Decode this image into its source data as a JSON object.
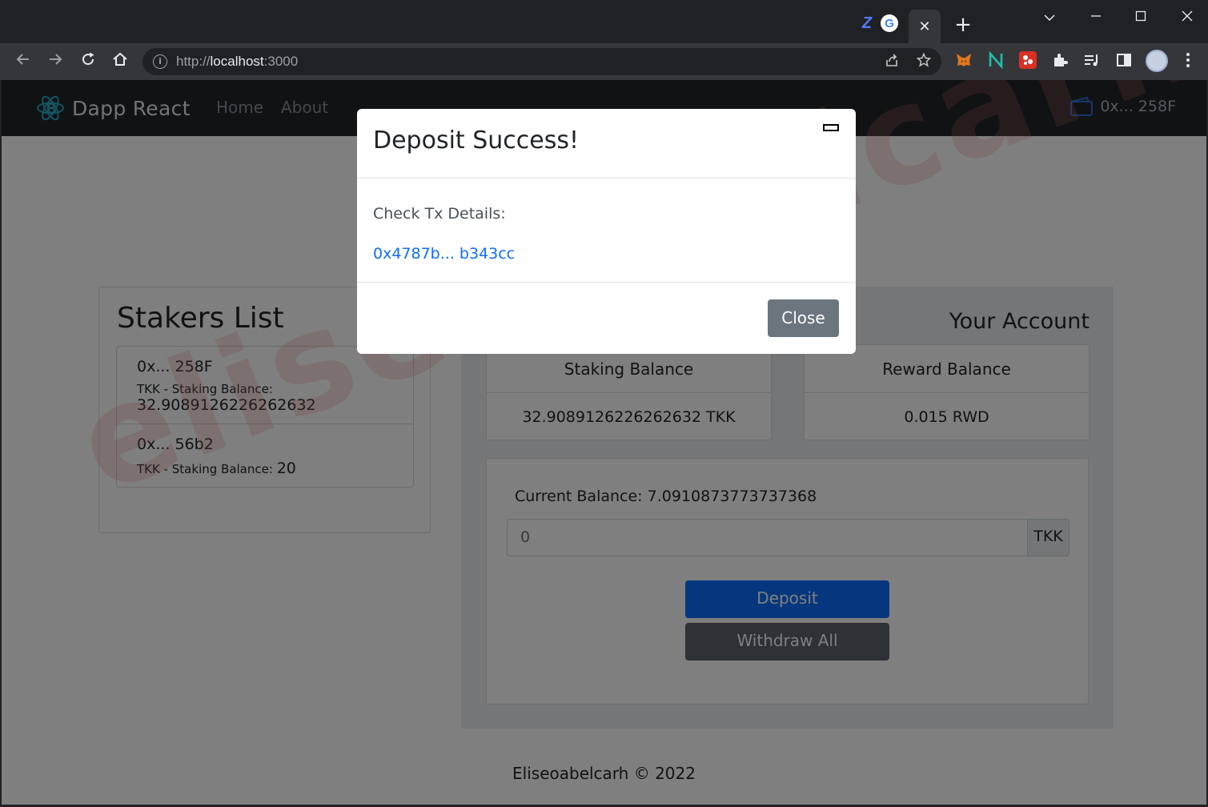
{
  "browser": {
    "url_scheme": "http://",
    "url_host": "localhost",
    "url_port": ":3000",
    "tab_close_glyph": "✕",
    "new_tab_glyph": "+"
  },
  "navbar": {
    "brand": "Dapp React",
    "links": [
      "Home",
      "About"
    ],
    "wallet_address": "0x... 258F"
  },
  "stakers": {
    "title": "Stakers List",
    "items": [
      {
        "address": "0x... 258F",
        "label": "TKK - Staking Balance:",
        "balance": "32.9089126226262632"
      },
      {
        "address": "0x... 56b2",
        "label": "TKK - Staking Balance:",
        "balance": "20"
      }
    ]
  },
  "account": {
    "title": "Your Account",
    "staking_balance_label": "Staking Balance",
    "staking_balance_value": "32.9089126226262632 TKK",
    "reward_balance_label": "Reward Balance",
    "reward_balance_value": "0.015 RWD",
    "current_balance": "Current Balance: 7.0910873773737368",
    "amount_value": "0",
    "amount_unit": "TKK",
    "deposit_label": "Deposit",
    "withdraw_label": "Withdraw All"
  },
  "footer": {
    "text": "Eliseoabelcarh © 2022"
  },
  "watermark": "eliseoabelcarh",
  "modal": {
    "title": "Deposit Success!",
    "body_label": "Check Tx Details:",
    "tx_link": "0x4787b... b343cc",
    "close_label": "Close"
  },
  "colors": {
    "navbar": "#212529",
    "primary": "#0d6efd",
    "secondary": "#6c757d",
    "brand_logo": "#61dafb"
  },
  "icons": [
    "info-icon",
    "share-icon",
    "star-icon",
    "metamask-icon",
    "extension-n-icon",
    "extension-red-icon",
    "puzzle-icon",
    "media-icon",
    "sidepanel-icon",
    "profile-avatar",
    "menu-dots-icon",
    "wallet-icon",
    "react-logo-icon"
  ]
}
